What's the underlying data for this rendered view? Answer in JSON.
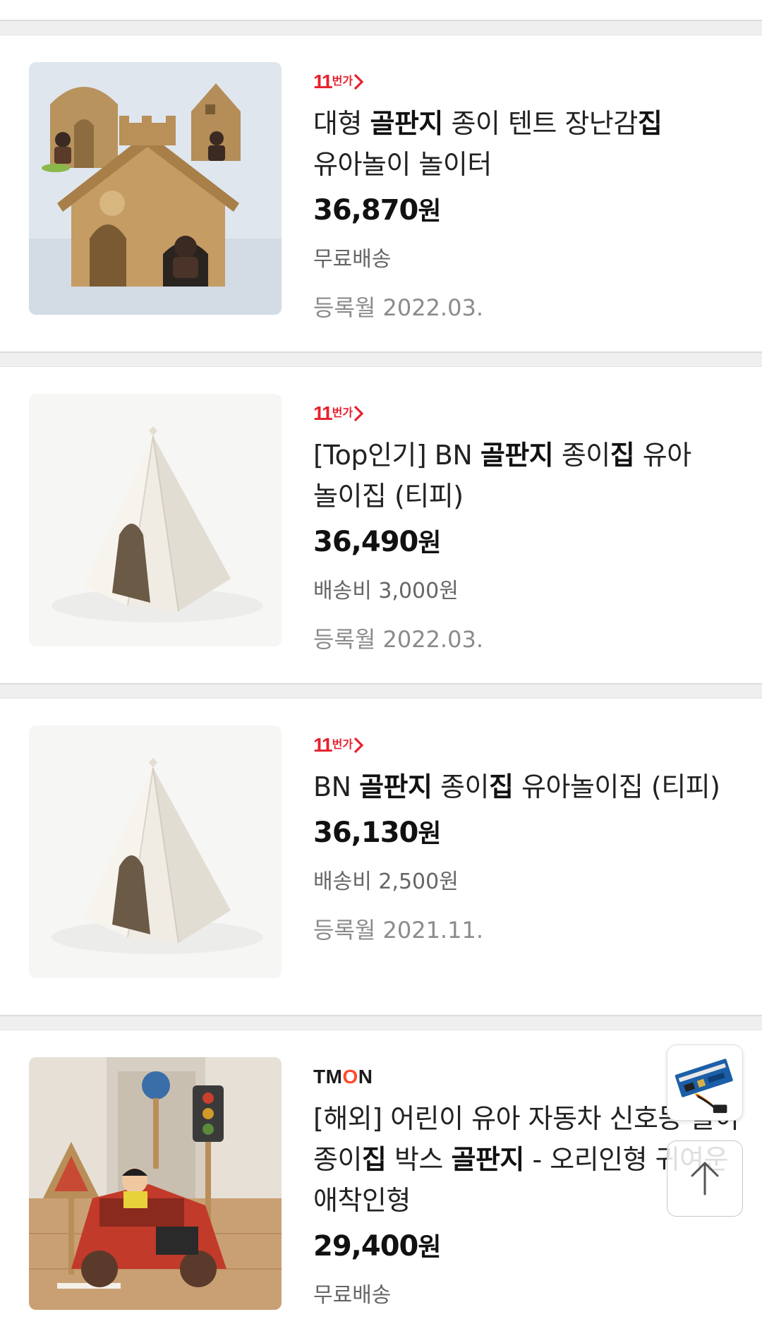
{
  "products": [
    {
      "store": "11번가",
      "title_parts": [
        {
          "t": "대형 ",
          "b": false
        },
        {
          "t": "골판지",
          "b": true
        },
        {
          "t": " 종이 텐트 장난감",
          "b": false
        },
        {
          "t": "집",
          "b": true
        },
        {
          "t": " 유아놀이 놀이터",
          "b": false
        }
      ],
      "price": "36,870",
      "won": "원",
      "shipping": "무료배송",
      "registered": "등록월 2022.03.",
      "image": "cardboard-house-photo"
    },
    {
      "store": "11번가",
      "title_parts": [
        {
          "t": "[Top인기] BN ",
          "b": false
        },
        {
          "t": "골판지",
          "b": true
        },
        {
          "t": " 종이",
          "b": false
        },
        {
          "t": "집",
          "b": true
        },
        {
          "t": " 유아 놀이집 (티피)",
          "b": false
        }
      ],
      "price": "36,490",
      "won": "원",
      "shipping": "배송비 3,000원",
      "registered": "등록월 2022.03.",
      "image": "teepee-photo"
    },
    {
      "store": "11번가",
      "title_parts": [
        {
          "t": "BN ",
          "b": false
        },
        {
          "t": "골판지",
          "b": true
        },
        {
          "t": " 종이",
          "b": false
        },
        {
          "t": "집",
          "b": true
        },
        {
          "t": " 유아놀이집 (티피)",
          "b": false
        }
      ],
      "price": "36,130",
      "won": "원",
      "shipping": "배송비 2,500원",
      "registered": "등록월 2021.11.",
      "image": "teepee-photo"
    },
    {
      "store": "TMON",
      "title_parts": [
        {
          "t": "[해외] 어린이 유아 자동차 신호등 놀이 종이",
          "b": false
        },
        {
          "t": "집",
          "b": true
        },
        {
          "t": " 박스 ",
          "b": false
        },
        {
          "t": "골판지",
          "b": true
        },
        {
          "t": " - 오리인형 귀여운 애착인형",
          "b": false
        }
      ],
      "price": "29,400",
      "won": "원",
      "shipping": "무료배송",
      "registered": "",
      "image": "cardboard-car-photo"
    }
  ],
  "logo_11st": {
    "num": "11",
    "ko": "번가"
  },
  "logo_tmon": {
    "pre": "TM",
    "o": "O",
    "post": "N"
  },
  "floating": {
    "recent_item": "circuit-board-thumbnail",
    "scroll_top": "arrow-up-icon"
  },
  "colors": {
    "brand_11st": "#e8202e",
    "tmon_o": "#ff4b2b",
    "divider": "#efefef"
  }
}
